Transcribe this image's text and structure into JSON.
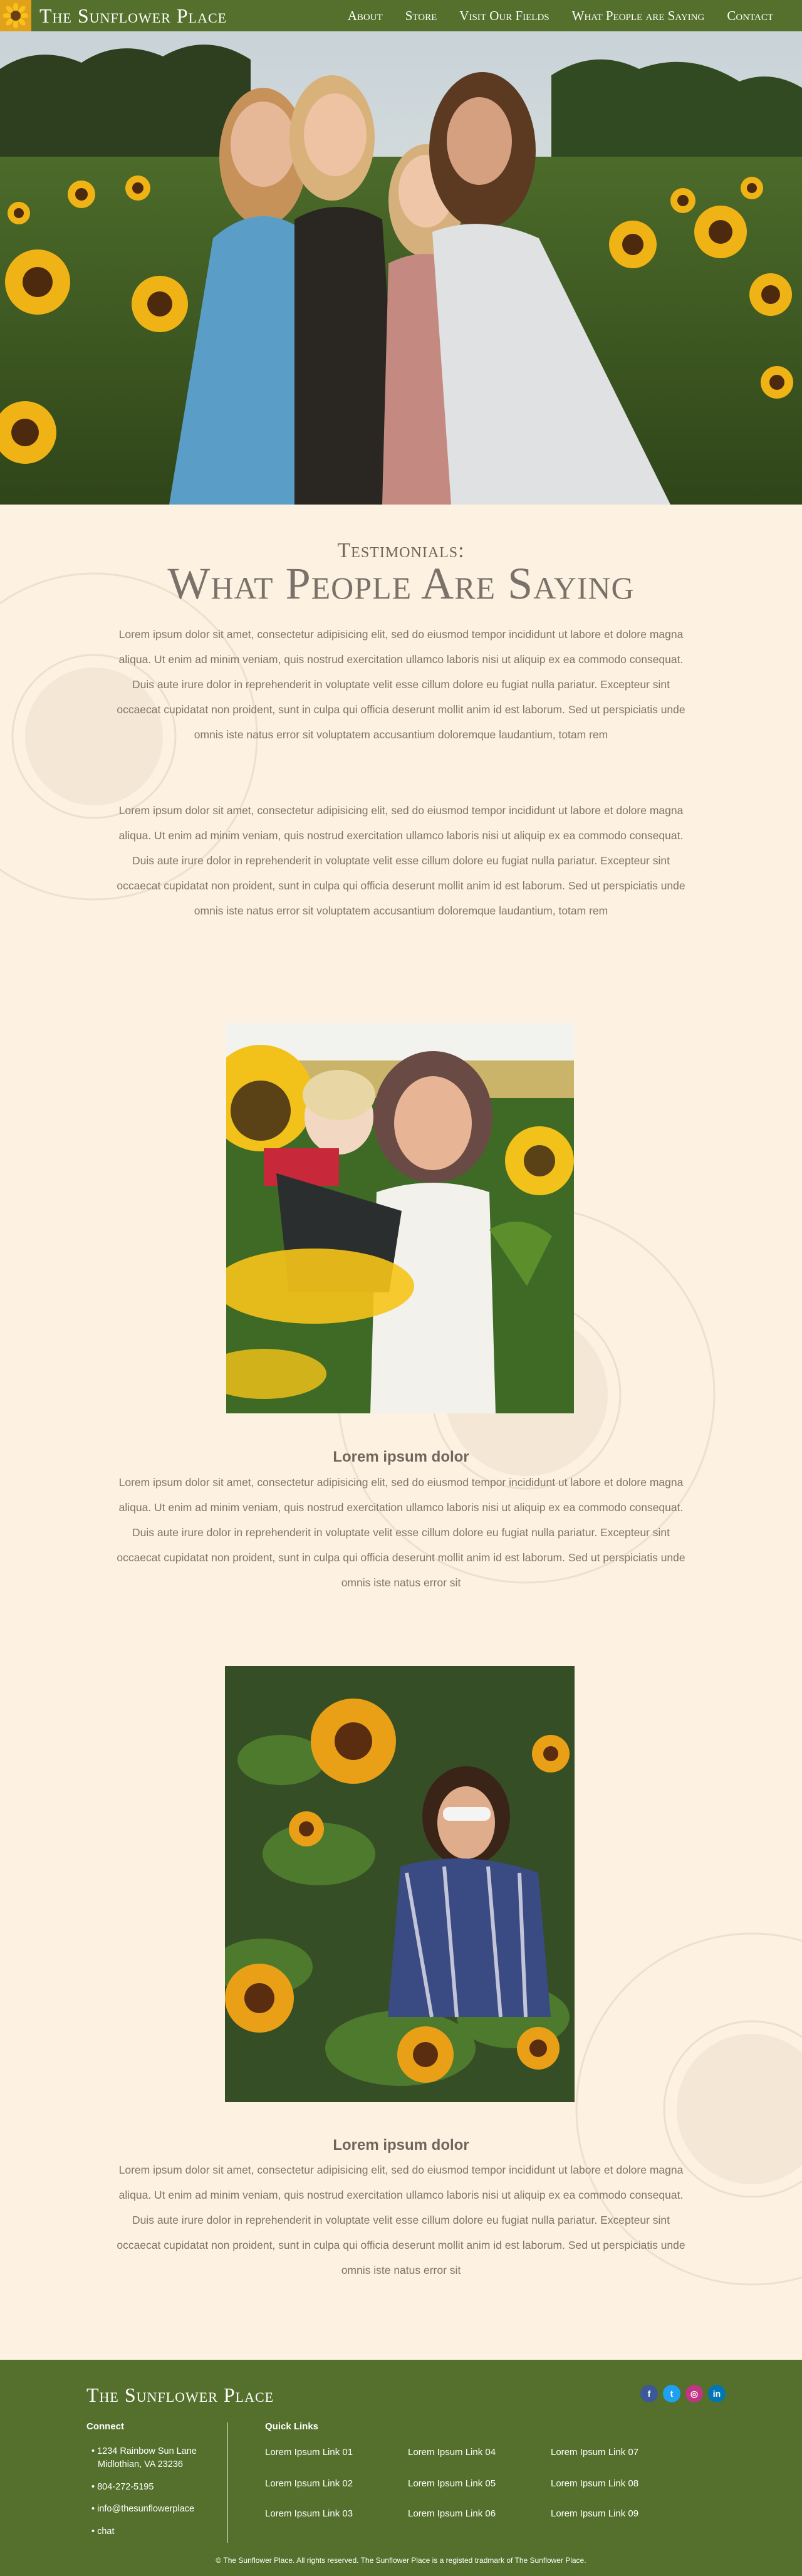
{
  "nav": {
    "brand": "The Sunflower Place",
    "items": [
      "About",
      "Store",
      "Visit Our Fields",
      "What People are Saying",
      "Contact"
    ]
  },
  "section": {
    "subtitle": "Testimonials:",
    "title": "What People Are Saying",
    "para1": "Lorem ipsum dolor sit amet, consectetur adipisicing elit, sed do eiusmod tempor incididunt ut labore et dolore magna aliqua. Ut enim ad minim veniam, quis nostrud exercitation ullamco laboris nisi ut aliquip ex ea commodo consequat. Duis aute irure dolor in reprehenderit in voluptate velit esse cillum dolore eu fugiat nulla pariatur. Excepteur sint occaecat cupidatat non proident, sunt in culpa qui officia deserunt mollit anim id est laborum. Sed ut perspiciatis unde omnis iste natus error sit voluptatem accusantium doloremque laudantium, totam rem",
    "para2": "Lorem ipsum dolor sit amet, consectetur adipisicing elit, sed do eiusmod tempor incididunt ut labore et dolore magna aliqua. Ut enim ad minim veniam, quis nostrud exercitation ullamco laboris nisi ut aliquip ex ea commodo consequat. Duis aute irure dolor in reprehenderit in voluptate velit esse cillum dolore eu fugiat nulla pariatur. Excepteur sint occaecat cupidatat non proident, sunt in culpa qui officia deserunt mollit anim id est laborum. Sed ut perspiciatis unde omnis iste natus error sit voluptatem accusantium doloremque laudantium, totam rem"
  },
  "testimonials": [
    {
      "title": "Lorem ipsum dolor",
      "text": "Lorem ipsum dolor sit amet, consectetur adipisicing elit, sed do eiusmod tempor incididunt ut labore et dolore magna aliqua. Ut enim ad minim veniam, quis nostrud exercitation ullamco laboris nisi ut aliquip ex ea commodo consequat. Duis aute irure dolor in reprehenderit in voluptate velit esse cillum dolore eu fugiat nulla pariatur. Excepteur sint occaecat cupidatat non proident, sunt in culpa qui officia deserunt mollit anim id est laborum. Sed ut perspiciatis unde omnis iste natus error sit"
    },
    {
      "title": "Lorem ipsum dolor",
      "text": "Lorem ipsum dolor sit amet, consectetur adipisicing elit, sed do eiusmod tempor incididunt ut labore et dolore magna aliqua. Ut enim ad minim veniam, quis nostrud exercitation ullamco laboris nisi ut aliquip ex ea commodo consequat. Duis aute irure dolor in reprehenderit in voluptate velit esse cillum dolore eu fugiat nulla pariatur. Excepteur sint occaecat cupidatat non proident, sunt in culpa qui officia deserunt mollit anim id est laborum. Sed ut perspiciatis unde omnis iste natus error sit"
    }
  ],
  "footer": {
    "brand": "The Sunflower Place",
    "connect_heading": "Connect",
    "address_line1": "• 1234 Rainbow Sun Lane",
    "address_line2": "Midlothian, VA 23236",
    "phone": "• 804-272-5195",
    "email": "• info@thesunflowerplace",
    "chat": "• chat",
    "quick_links_heading": "Quick Links",
    "links": [
      "Lorem Ipsum Link 01",
      "Lorem Ipsum Link 04",
      "Lorem Ipsum Link 07",
      "Lorem Ipsum Link 02",
      "Lorem Ipsum Link 05",
      "Lorem Ipsum Link 08",
      "Lorem Ipsum Link 03",
      "Lorem Ipsum Link 06",
      "Lorem Ipsum Link 09"
    ],
    "social": [
      {
        "icon": "facebook-icon",
        "glyph": "f",
        "color": "#3b5998"
      },
      {
        "icon": "twitter-icon",
        "glyph": "t",
        "color": "#1da1f2"
      },
      {
        "icon": "instagram-icon",
        "glyph": "◎",
        "color": "#c13584"
      },
      {
        "icon": "linkedin-icon",
        "glyph": "in",
        "color": "#0077b5"
      }
    ],
    "copyright": "© The Sunflower Place. All rights reserved. The Sunflower Place is a registed tradmark of The Sunflower Place."
  },
  "colors": {
    "nav_green": "#54702c",
    "logo_gold": "#e2a11a",
    "page_bg": "#fdf1e1"
  }
}
